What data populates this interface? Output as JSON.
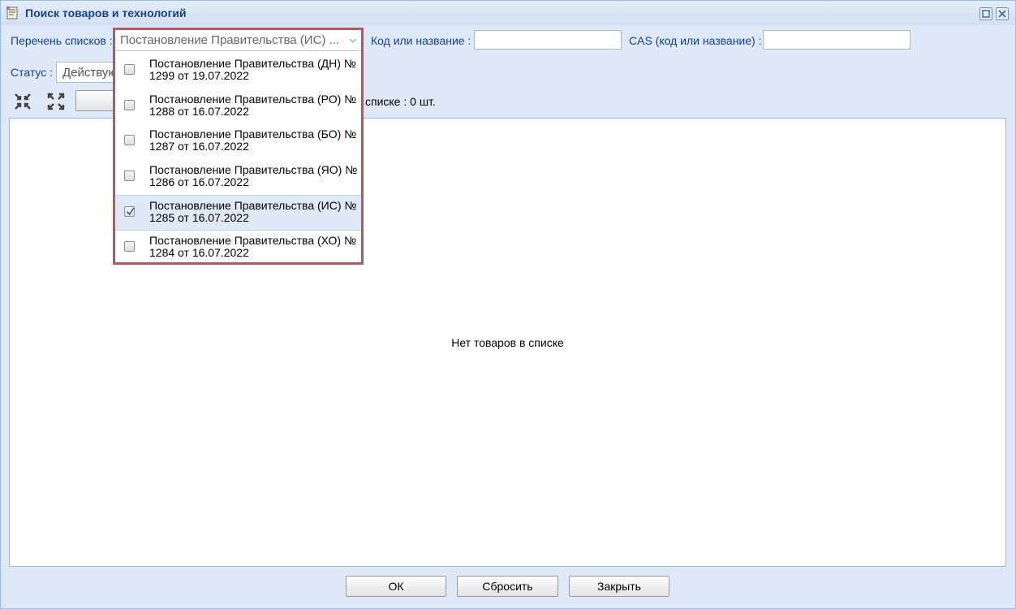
{
  "window": {
    "title": "Поиск товаров и технологий"
  },
  "filters": {
    "list_label": "Перечень списков :",
    "list_value": "Постановление Правительства (ИС) ...",
    "code_label": "Код или название :",
    "code_value": "",
    "cas_label": "CAS (код или название) :",
    "cas_value": "",
    "status_label": "Статус :",
    "status_value": "Действую"
  },
  "toolbar": {
    "count_text": "списке : 0 шт."
  },
  "grid": {
    "empty_text": "Нет товаров в списке"
  },
  "dropdown": {
    "items": [
      {
        "label": "Постановление Правительства (ДН) № 1299 от 19.07.2022",
        "checked": false
      },
      {
        "label": "Постановление Правительства (РО) № 1288 от 16.07.2022",
        "checked": false
      },
      {
        "label": "Постановление Правительства (БО) № 1287 от 16.07.2022",
        "checked": false
      },
      {
        "label": "Постановление Правительства (ЯО) № 1286 от 16.07.2022",
        "checked": false
      },
      {
        "label": "Постановление Правительства (ИС) № 1285 от 16.07.2022",
        "checked": true
      },
      {
        "label": "Постановление Правительства (ХО) № 1284 от 16.07.2022",
        "checked": false
      }
    ]
  },
  "footer": {
    "ok_label": "ОК",
    "reset_label": "Сбросить",
    "close_label": "Закрыть"
  }
}
